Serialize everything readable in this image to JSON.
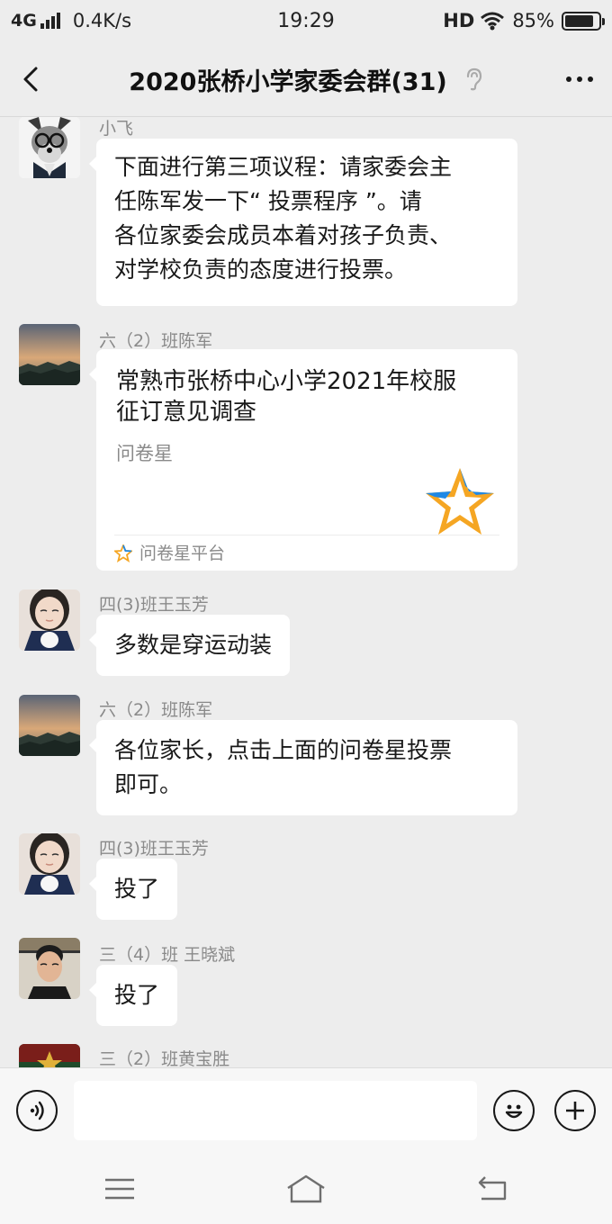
{
  "status_bar": {
    "network": "4G",
    "speed": "0.4K/s",
    "time": "19:29",
    "hd": "HD",
    "battery_percent": "85%",
    "battery_level": 0.85,
    "icons": [
      "signal-icon",
      "wifi-icon",
      "battery-icon"
    ]
  },
  "nav": {
    "title": "2020张桥小学家委会群(31)",
    "icons": [
      "back-icon",
      "ear-icon",
      "more-icon"
    ]
  },
  "messages": [
    {
      "sender": "小飞",
      "text": [
        "下面进行第三项议程：请家委会主",
        "任陈军发一下“ 投票程序 ”。请",
        "各位家委会成员本着对孩子负责、",
        "对学校负责的态度进行投票。"
      ]
    },
    {
      "sender": "六（2）班陈军",
      "card_title": [
        "常熟市张桥中心小学2021年校服",
        "征订意见调查"
      ],
      "card_desc": "问卷星",
      "card_footer": "问卷星平台"
    },
    {
      "sender": "四(3)班王玉芳",
      "text": [
        "多数是穿运动装"
      ]
    },
    {
      "sender": "六（2）班陈军",
      "text": [
        "各位家长，点击上面的问卷星投票",
        "即可。"
      ]
    },
    {
      "sender": "四(3)班王玉芳",
      "text": [
        "投了"
      ]
    },
    {
      "sender": "三（4）班 王晓斌",
      "text": [
        "投了"
      ]
    },
    {
      "sender": "三（2）班黄宝胜"
    }
  ],
  "input_bar": {
    "value": "",
    "icons": [
      "voice-icon",
      "emoji-icon",
      "plus-icon"
    ]
  },
  "system_nav": {
    "icons": [
      "menu-icon",
      "home-icon",
      "back-nav-icon"
    ]
  },
  "colors": {
    "background": "#ededed",
    "bubble": "#ffffff",
    "sender_name": "#8a8a8a",
    "star_orange": "#f5a623",
    "star_blue": "#1e88e5"
  }
}
